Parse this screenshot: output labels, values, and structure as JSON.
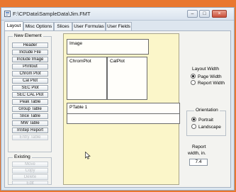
{
  "window": {
    "title": "F:\\CPData\\SampleData\\Jim.FMT",
    "controls": [
      "–",
      "□",
      "×"
    ]
  },
  "tabs": [
    "Layout",
    "Misc Options",
    "Slices",
    "User Formulas",
    "User Fields"
  ],
  "active_tab": "Layout",
  "new_element": {
    "label": "New Element",
    "buttons": [
      {
        "label": "Header",
        "enabled": true
      },
      {
        "label": "Include File",
        "enabled": true
      },
      {
        "label": "Include Image",
        "enabled": true
      },
      {
        "label": "Printout",
        "enabled": true
      },
      {
        "label": "Chrom Plot",
        "enabled": true
      },
      {
        "label": "Cal Plot",
        "enabled": true
      },
      {
        "label": "SEC Plot",
        "enabled": true
      },
      {
        "label": "SEC CAL Plot",
        "enabled": true
      },
      {
        "label": "Peak Table",
        "enabled": true
      },
      {
        "label": "Group Table",
        "enabled": true
      },
      {
        "label": "Slice Table",
        "enabled": true
      },
      {
        "label": "MW Table",
        "enabled": true
      },
      {
        "label": "InStep Report",
        "enabled": true
      },
      {
        "label": "Entry Table",
        "enabled": false
      }
    ]
  },
  "existing": {
    "label": "Existing",
    "buttons": [
      {
        "label": "Move",
        "enabled": false
      },
      {
        "label": "Copy",
        "enabled": false
      },
      {
        "label": "Delete",
        "enabled": false
      },
      {
        "label": "Edit",
        "enabled": false
      }
    ]
  },
  "layout_blocks": {
    "image": "Image",
    "chrom_plot": "ChromPlot",
    "cal_plot": "CalPlot",
    "ptable": "PTable 1"
  },
  "layout_width": {
    "label": "Layout Width",
    "options": [
      "Page Width",
      "Report Width"
    ],
    "selected": "Page Width"
  },
  "orientation": {
    "label": "Orientation",
    "options": [
      "Portrait",
      "Landscape"
    ],
    "selected": "Portrait"
  },
  "report_width": {
    "label_line1": "Report",
    "label_line2": "width, in.",
    "value": "7.4"
  }
}
